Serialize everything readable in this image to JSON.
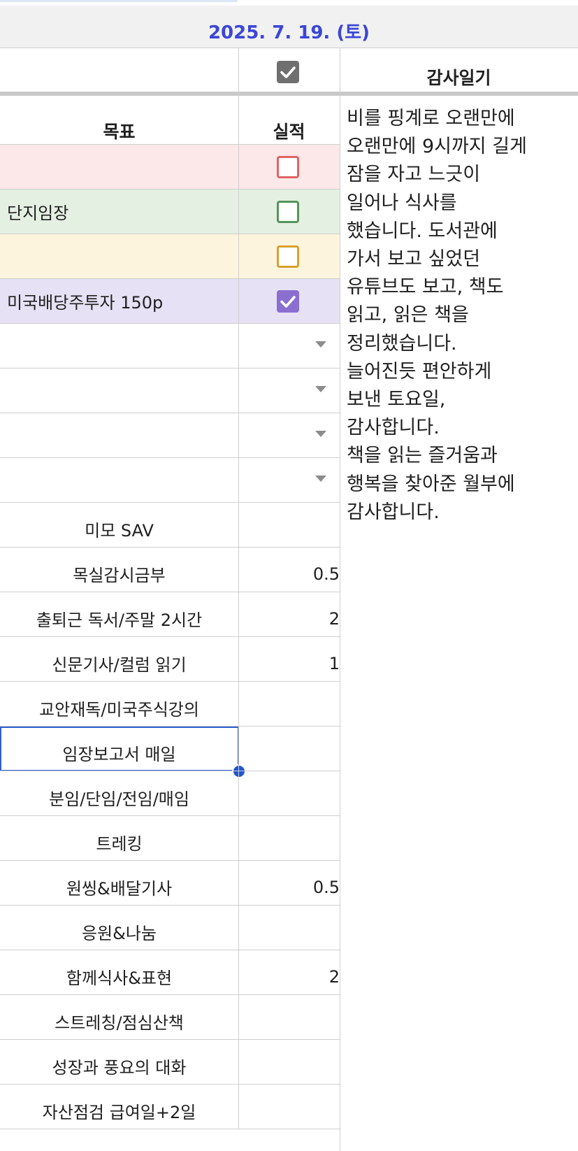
{
  "date_header": "2025. 7. 19. (토)",
  "header": {
    "diary_title": "감사일기",
    "goal_col": "목표",
    "result_col": "실적"
  },
  "colors": {
    "date_text": "#3b46d8",
    "row_red": "#fce8e8",
    "row_green": "#e4f0e1",
    "row_yellow": "#fdf4dd",
    "row_purple": "#e6e1f4",
    "cb_red": "#e06464",
    "cb_green": "#55955a",
    "cb_yellow": "#d6a12c",
    "cb_purple": "#8a6fd0",
    "cb_header": "#6f6f6f",
    "selection": "#2f5fd1"
  },
  "goal_rows": [
    {
      "goal": "",
      "checked": false,
      "color": "red"
    },
    {
      "goal": "단지임장",
      "checked": false,
      "color": "green"
    },
    {
      "goal": "",
      "checked": false,
      "color": "yellow"
    },
    {
      "goal": "미국배당주투자 150p",
      "checked": true,
      "color": "purple"
    }
  ],
  "habit_rows": [
    {
      "label": "미모 SAV",
      "value": ""
    },
    {
      "label": "목실감시금부",
      "value": "0.5"
    },
    {
      "label": "출퇴근 독서/주말 2시간",
      "value": "2"
    },
    {
      "label": "신문기사/컬럼 읽기",
      "value": "1"
    },
    {
      "label": "교안재독/미국주식강의",
      "value": ""
    },
    {
      "label": "임장보고서  매일",
      "value": ""
    },
    {
      "label": "분임/단임/전임/매임",
      "value": ""
    },
    {
      "label": "트레킹",
      "value": ""
    },
    {
      "label": "원씽&배달기사",
      "value": "0.5"
    },
    {
      "label": "응원&나눔",
      "value": ""
    },
    {
      "label": "함께식사&표현",
      "value": "2"
    },
    {
      "label": "스트레칭/점심산책",
      "value": ""
    },
    {
      "label": "성장과 풍요의 대화",
      "value": ""
    },
    {
      "label": "자산점검 급여일+2일",
      "value": ""
    }
  ],
  "diary_lines": [
    "비를 핑계로 오랜만에",
    "오랜만에  9시까지 길게",
    "잠을 자고 느긋이",
    "일어나 식사를",
    "했습니다. 도서관에",
    "가서 보고 싶었던",
    "유튜브도 보고, 책도",
    "읽고, 읽은 책을",
    "정리했습니다.",
    "늘어진듯 편안하게",
    "보낸 토요일,",
    "감사합니다.",
    "책을 읽는 즐거움과",
    "행복을 찾아준 월부에",
    "감사합니다."
  ]
}
